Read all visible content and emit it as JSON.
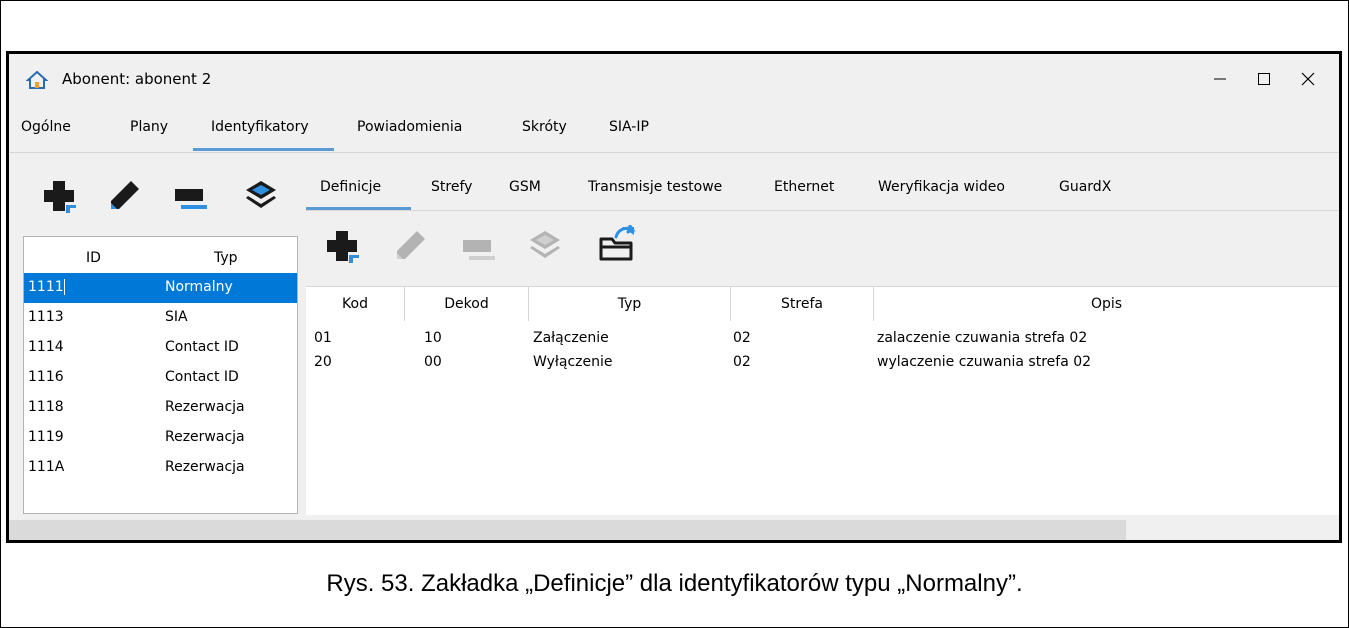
{
  "window": {
    "title": "Abonent: abonent 2",
    "icon": "home-icon"
  },
  "menu": {
    "items": [
      {
        "label": "Ogólne"
      },
      {
        "label": "Plany"
      },
      {
        "label": "Identyfikatory",
        "active": true
      },
      {
        "label": "Powiadomienia"
      },
      {
        "label": "Skróty"
      },
      {
        "label": "SIA-IP"
      }
    ]
  },
  "toolbar": {
    "icons": [
      "add-icon",
      "edit-icon",
      "remove-icon",
      "layers-icon"
    ]
  },
  "id_table": {
    "headers": [
      "ID",
      "Typ"
    ],
    "rows": [
      {
        "id": "1111",
        "typ": "Normalny",
        "selected": true
      },
      {
        "id": "1113",
        "typ": "SIA"
      },
      {
        "id": "1114",
        "typ": "Contact ID"
      },
      {
        "id": "1116",
        "typ": "Contact ID"
      },
      {
        "id": "1118",
        "typ": "Rezerwacja"
      },
      {
        "id": "1119",
        "typ": "Rezerwacja"
      },
      {
        "id": "111A",
        "typ": "Rezerwacja"
      }
    ]
  },
  "subtabs": [
    {
      "label": "Definicje",
      "active": true
    },
    {
      "label": "Strefy"
    },
    {
      "label": "GSM"
    },
    {
      "label": "Transmisje testowe"
    },
    {
      "label": "Ethernet"
    },
    {
      "label": "Weryfikacja wideo"
    },
    {
      "label": "GuardX"
    }
  ],
  "def_toolbar": {
    "icons": [
      "add-icon",
      "edit-icon",
      "remove-icon",
      "layers-icon",
      "open-folder-icon"
    ]
  },
  "definitions": {
    "headers": [
      "Kod",
      "Dekod",
      "Typ",
      "Strefa",
      "Opis"
    ],
    "rows": [
      {
        "kod": "01",
        "dekod": "10",
        "typ": "Załączenie",
        "strefa": "02",
        "opis": "zalaczenie czuwania strefa 02"
      },
      {
        "kod": "20",
        "dekod": "00",
        "typ": "Wyłączenie",
        "strefa": "02",
        "opis": "wylaczenie czuwania strefa 02"
      }
    ]
  },
  "caption": "Rys. 53. Zakładka „Definicje” dla identyfikatorów typu „Normalny”.",
  "colors": {
    "accent": "#0078d7",
    "tab_underline": "#5b9bd5",
    "icon_dark": "#1a1a1a",
    "icon_disabled": "#b3b3b3"
  }
}
